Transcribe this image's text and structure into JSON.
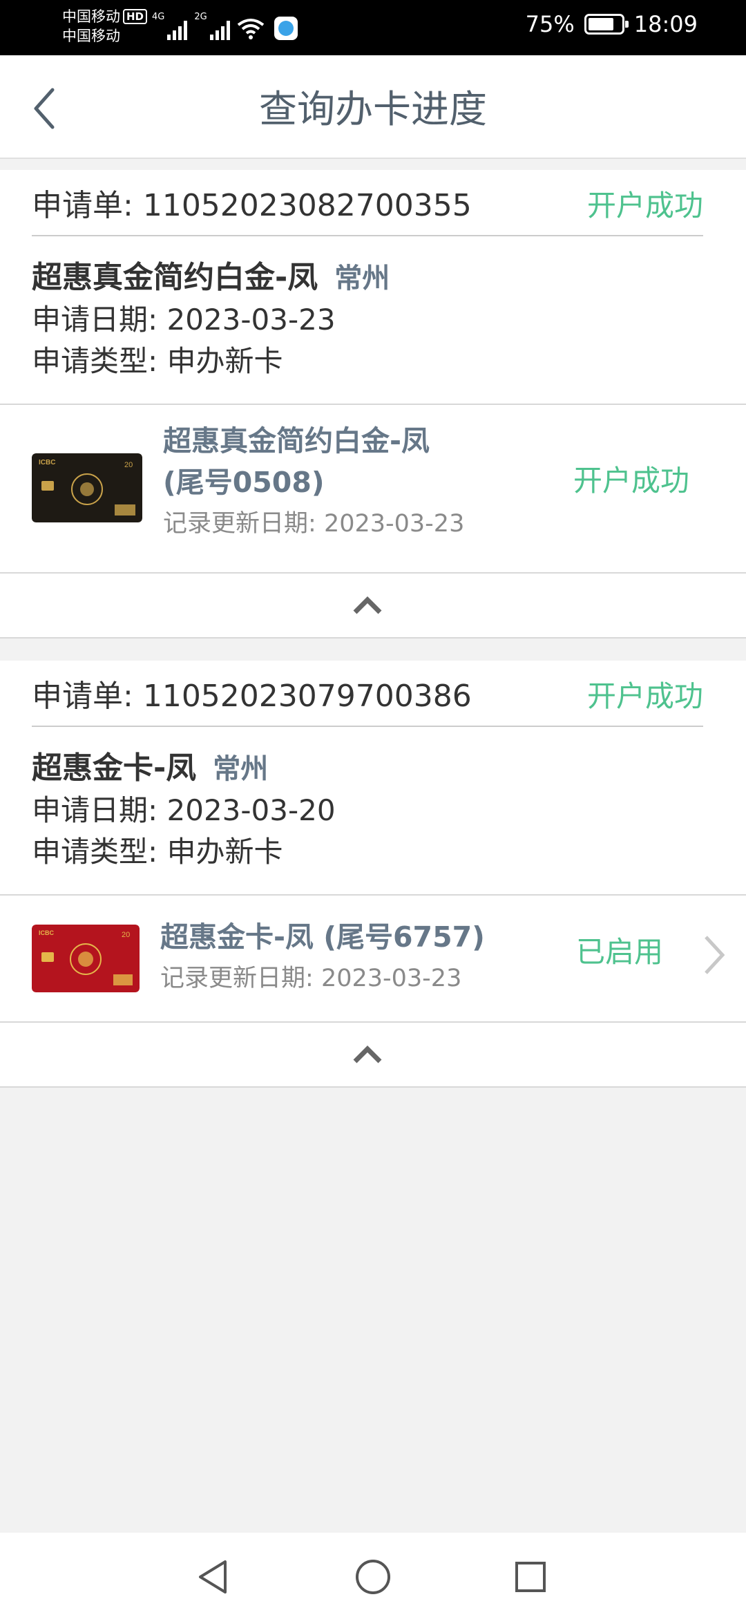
{
  "status_bar": {
    "carrier_1": "中国移动",
    "hd_badge": "HD",
    "carrier_2": "中国移动",
    "net_tag_1": "4G",
    "net_tag_2": "2G",
    "battery_percent": "75%",
    "time": "18:09"
  },
  "header": {
    "title": "查询办卡进度",
    "back_icon": "chevron-left-icon"
  },
  "applications": [
    {
      "app_label": "申请单:",
      "app_number": "11052023082700355",
      "status": "开户成功",
      "card_name": "超惠真金简约白金-凤",
      "city": "常州",
      "date_label": "申请日期:",
      "date": "2023-03-23",
      "type_label": "申请类型:",
      "type": "申办新卡",
      "card": {
        "name_line1": "超惠真金简约白金-凤",
        "name_line2": "(尾号0508)",
        "update_label": "记录更新日期:",
        "update_date": "2023-03-23",
        "status": "开户成功",
        "card_color": "#1e1a14",
        "card_accent": "#c9a24a"
      }
    },
    {
      "app_label": "申请单:",
      "app_number": "11052023079700386",
      "status": "开户成功",
      "card_name": "超惠金卡-凤",
      "city": "常州",
      "date_label": "申请日期:",
      "date": "2023-03-20",
      "type_label": "申请类型:",
      "type": "申办新卡",
      "card": {
        "name_line1": "超惠金卡-凤 (尾号6757)",
        "update_label": "记录更新日期:",
        "update_date": "2023-03-23",
        "status": "已启用",
        "card_color": "#b4141e",
        "card_accent": "#e5b64a"
      }
    }
  ],
  "colors": {
    "success_green": "#4ec28e",
    "title_gray": "#52606d",
    "page_bg": "#f2f2f2"
  },
  "system_nav": {
    "back_icon": "triangle-back-icon",
    "home_icon": "circle-home-icon",
    "recents_icon": "square-recents-icon"
  }
}
